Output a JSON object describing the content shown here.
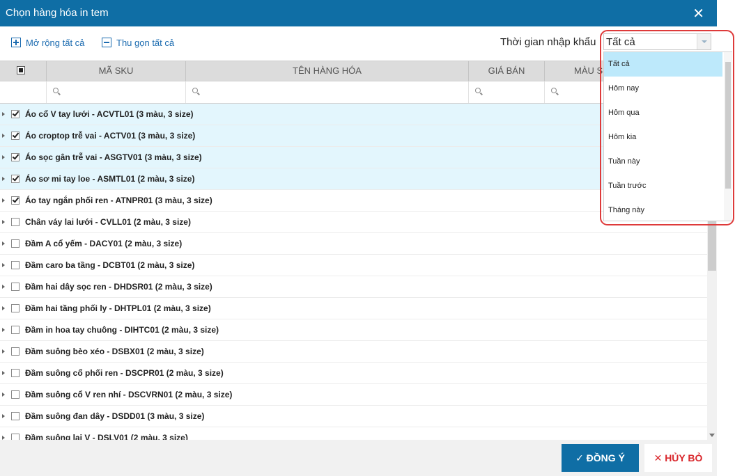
{
  "dialog": {
    "title": "Chọn hàng hóa in tem",
    "close_icon": "close-icon"
  },
  "toolbar": {
    "expand_all": "Mở rộng tất cả",
    "collapse_all": "Thu gọn tất cả",
    "time_label": "Thời gian nhập khẩu",
    "time_value": "Tất cả"
  },
  "table": {
    "columns": [
      "MÃ SKU",
      "TÊN HÀNG HÓA",
      "GIÁ BÁN",
      "MÀU S"
    ],
    "rows": [
      {
        "label": "Áo cổ V tay lưới - ACVTL01 (3 màu, 3 size)",
        "checked": true
      },
      {
        "label": "Áo croptop trễ vai - ACTV01 (3 màu, 3 size)",
        "checked": true
      },
      {
        "label": "Áo sọc gân trễ vai - ASGTV01 (3 màu, 3 size)",
        "checked": true
      },
      {
        "label": "Áo sơ mi tay loe - ASMTL01 (2 màu, 3 size)",
        "checked": true
      },
      {
        "label": "Áo tay ngắn phối ren - ATNPR01 (3 màu, 3 size)",
        "checked": true
      },
      {
        "label": "Chân váy lai lưới - CVLL01 (2 màu, 3 size)",
        "checked": false
      },
      {
        "label": "Đầm A cổ yếm - DACY01 (2 màu, 3 size)",
        "checked": false
      },
      {
        "label": "Đầm caro ba tầng - DCBT01 (2 màu, 3 size)",
        "checked": false
      },
      {
        "label": "Đầm hai dây sọc ren - DHDSR01 (2 màu, 3 size)",
        "checked": false
      },
      {
        "label": "Đầm hai tầng phối ly - DHTPL01 (2 màu, 3 size)",
        "checked": false
      },
      {
        "label": "Đầm in hoa tay chuông - DIHTC01 (2 màu, 3 size)",
        "checked": false
      },
      {
        "label": "Đầm suông bèo xéo - DSBX01 (2 màu, 3 size)",
        "checked": false
      },
      {
        "label": "Đầm suông cổ phối ren - DSCPR01 (2 màu, 3 size)",
        "checked": false
      },
      {
        "label": "Đầm suông cổ V ren nhí - DSCVRN01 (2 màu, 3 size)",
        "checked": false
      },
      {
        "label": "Đầm suông đan dây - DSDD01 (3 màu, 3 size)",
        "checked": false
      },
      {
        "label": "Đầm suông lai V - DSLV01 (2 màu, 3 size)",
        "checked": false
      }
    ]
  },
  "dropdown": {
    "options": [
      "Tất cả",
      "Hôm nay",
      "Hôm qua",
      "Hôm kia",
      "Tuần này",
      "Tuần trước",
      "Tháng này"
    ],
    "selected": "Tất cả"
  },
  "footer": {
    "ok": "✓ ĐỒNG Ý",
    "cancel": "✕ HỦY BỎ"
  },
  "colors": {
    "primary": "#0f6ea5",
    "selected_row": "#e3f6fd",
    "danger": "#d9262b",
    "highlight": "#de3a3a"
  }
}
